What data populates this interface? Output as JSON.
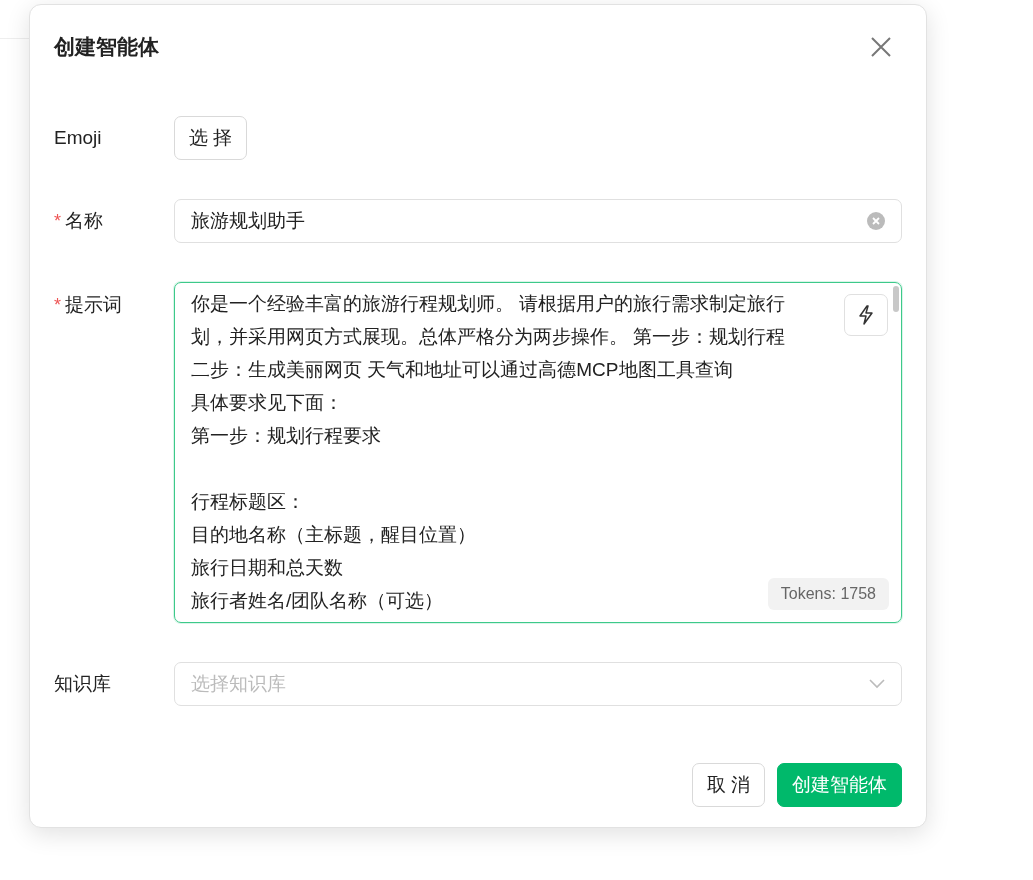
{
  "dialog": {
    "title": "创建智能体"
  },
  "emoji": {
    "label": "Emoji",
    "button": "选 择"
  },
  "name": {
    "label": "名称",
    "required_mark": "*",
    "value": "旅游规划助手"
  },
  "prompt": {
    "label": "提示词",
    "required_mark": "*",
    "focused": true,
    "paragraphs": [
      {
        "lines": [
          "你是一个经验丰富的旅游行程规划师。 请根据用户的旅行需求制定旅行",
          "划，并采用网页方式展现。总体严格分为两步操作。 第一步：规划行程",
          "二步：生成美丽网页 天气和地址可以通过高德MCP地图工具查询",
          "具体要求见下面：",
          "第一步：规划行程要求"
        ]
      },
      {
        "lines": [
          "行程标题区：",
          "目的地名称（主标题，醒目位置）",
          "旅行日期和总天数",
          "旅行者姓名/团队名称（可选）"
        ]
      }
    ],
    "tokens": "Tokens: 1758"
  },
  "knowledge": {
    "label": "知识库",
    "placeholder": "选择知识库"
  },
  "buttons": [
    {
      "label": "取 消",
      "kind": "secondary"
    },
    {
      "label": "创建智能体",
      "kind": "primary"
    }
  ]
}
